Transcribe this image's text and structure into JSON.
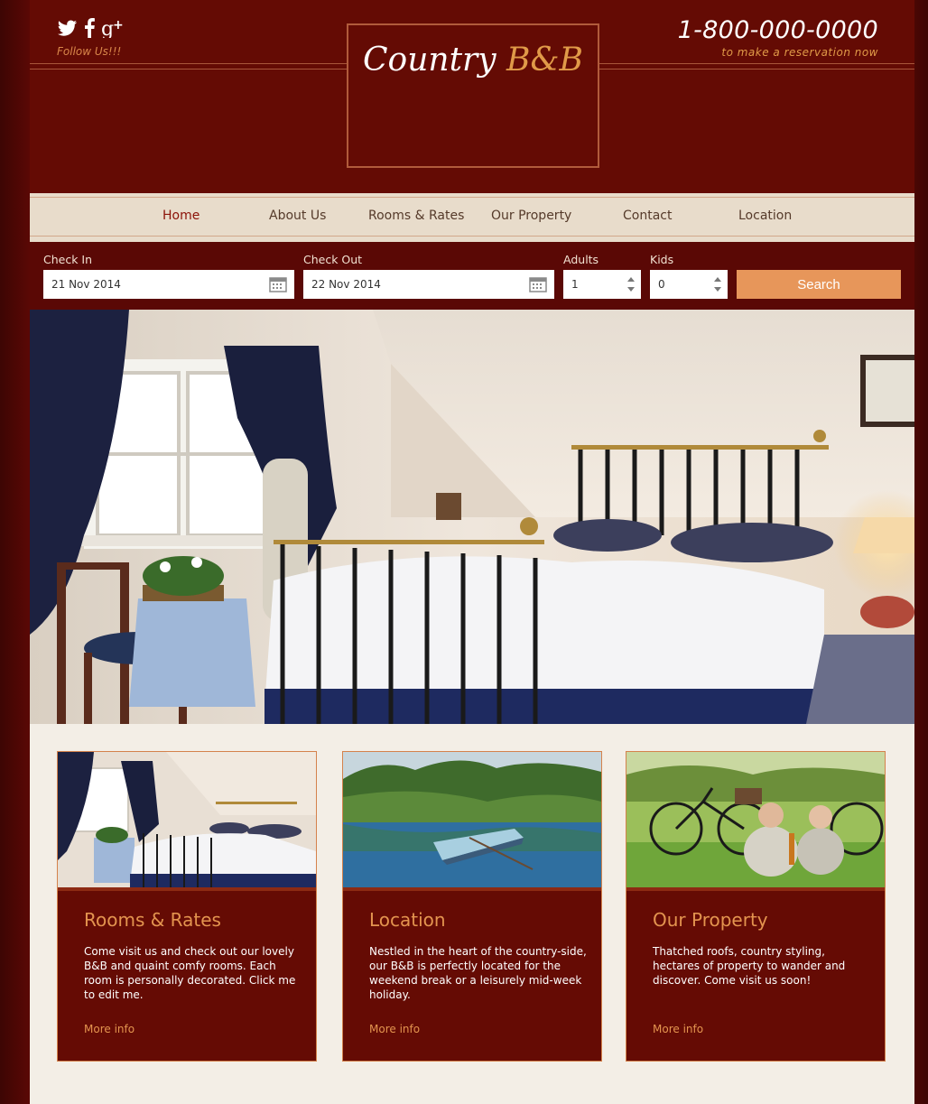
{
  "header": {
    "follow_label": "Follow Us!!!",
    "social": [
      "twitter-icon",
      "facebook-icon",
      "google-plus-icon"
    ],
    "logo_part1": "Country",
    "logo_part2": "B&B",
    "phone": "1-800-000-0000",
    "phone_sub": "to make a reservation now"
  },
  "nav": {
    "items": [
      "Home",
      "About Us",
      "Rooms & Rates",
      "Our Property",
      "Contact",
      "Location"
    ],
    "active": "Home"
  },
  "booking": {
    "check_in_label": "Check In",
    "check_in_value": "21 Nov 2014",
    "check_out_label": "Check Out",
    "check_out_value": "22 Nov 2014",
    "adults_label": "Adults",
    "adults_value": "1",
    "kids_label": "Kids",
    "kids_value": "0",
    "search_label": "Search"
  },
  "cards": [
    {
      "title": "Rooms & Rates",
      "text": "Come visit us and check out our lovely B&B and quaint comfy rooms. Each room is personally decorated. Click me to edit me.",
      "more": "More info"
    },
    {
      "title": "Location",
      "text": "Nestled in the heart of the country-side, our B&B is perfectly located for the weekend break or a leisurely mid-week holiday.",
      "more": "More info"
    },
    {
      "title": "Our Property",
      "text": "Thatched roofs, country styling, hectares of property to wander and discover. Come visit us soon!",
      "more": "More info"
    }
  ],
  "colors": {
    "maroon": "#640b04",
    "accent_orange": "#e3944f",
    "nav_bg": "#e8dccb",
    "search_button": "#e7965a"
  }
}
